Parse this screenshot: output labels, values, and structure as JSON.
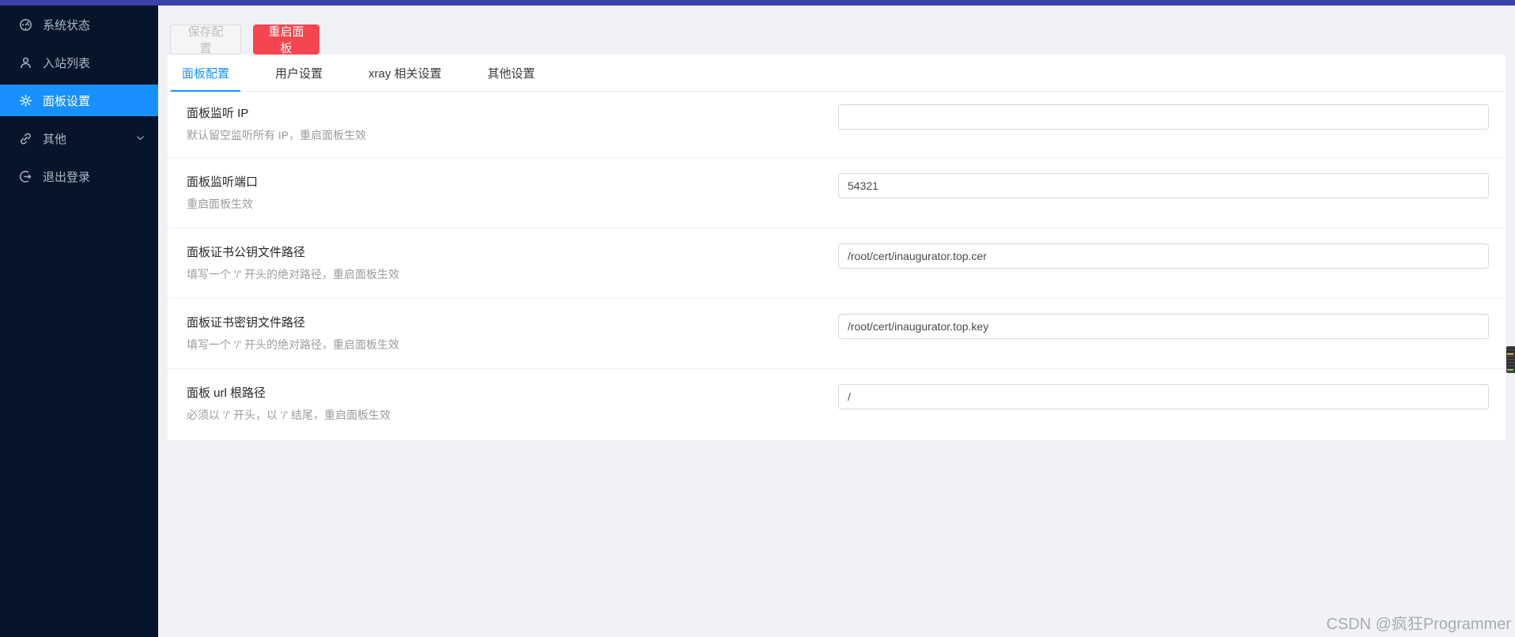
{
  "sidebar": {
    "items": [
      {
        "label": "系统状态",
        "icon": "dashboard-icon",
        "active": false
      },
      {
        "label": "入站列表",
        "icon": "user-icon",
        "active": false
      },
      {
        "label": "面板设置",
        "icon": "gear-icon",
        "active": true
      },
      {
        "label": "其他",
        "icon": "link-icon",
        "active": false,
        "has_submenu": true
      },
      {
        "label": "退出登录",
        "icon": "logout-icon",
        "active": false
      }
    ]
  },
  "header": {
    "save_label": "保存配置",
    "restart_label": "重启面板"
  },
  "tabs": [
    {
      "label": "面板配置",
      "active": true
    },
    {
      "label": "用户设置",
      "active": false
    },
    {
      "label": "xray 相关设置",
      "active": false
    },
    {
      "label": "其他设置",
      "active": false
    }
  ],
  "form": {
    "rows": [
      {
        "label": "面板监听 IP",
        "desc": "默认留空监听所有 IP，重启面板生效",
        "value": ""
      },
      {
        "label": "面板监听端口",
        "desc": "重启面板生效",
        "value": "54321"
      },
      {
        "label": "面板证书公钥文件路径",
        "desc": "填写一个 '/' 开头的绝对路径，重启面板生效",
        "value": "/root/cert/inaugurator.top.cer"
      },
      {
        "label": "面板证书密钥文件路径",
        "desc": "填写一个 '/' 开头的绝对路径，重启面板生效",
        "value": "/root/cert/inaugurator.top.key"
      },
      {
        "label": "面板 url 根路径",
        "desc": "必须以 '/' 开头，以 '/' 结尾，重启面板生效",
        "value": "/"
      }
    ]
  },
  "watermark": "CSDN @疯狂Programmer",
  "colors": {
    "topbar": "#3a41a8",
    "sidebar_bg": "#07152a",
    "active_blue": "#1890ff",
    "restart_red": "#f5454f",
    "page_bg": "#f0f2f5",
    "minimap_orange": "#e8a33d",
    "minimap_green": "#7ccf5f"
  }
}
